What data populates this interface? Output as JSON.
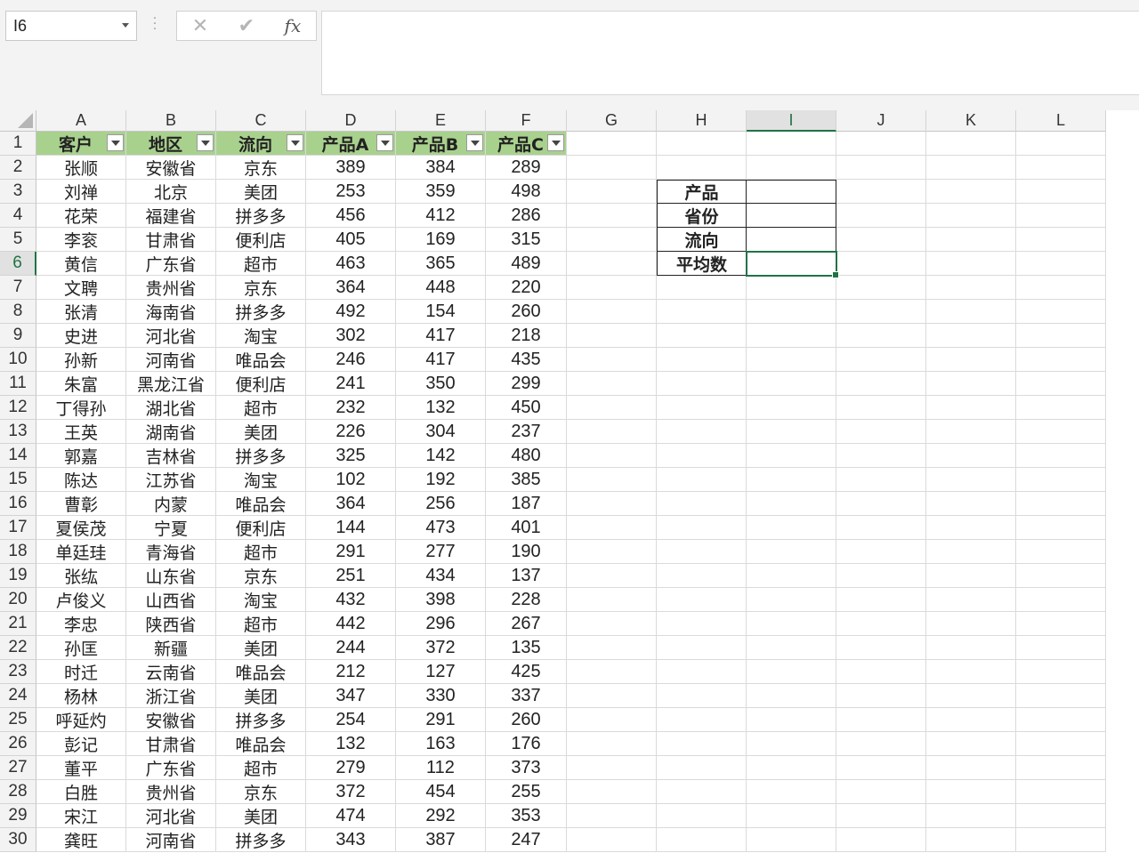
{
  "formula_bar": {
    "name_box": "I6",
    "cancel_icon": "✕",
    "enter_icon": "✔",
    "function_icon": "fx",
    "formula": ""
  },
  "columns": [
    "A",
    "B",
    "C",
    "D",
    "E",
    "F",
    "G",
    "H",
    "I",
    "J",
    "K",
    "L"
  ],
  "selected_column": "I",
  "selected_row": 6,
  "table": {
    "headers": [
      "客户",
      "地区",
      "流向",
      "产品A",
      "产品B",
      "产品C"
    ],
    "header_color": "#a9d18e",
    "rows": [
      [
        "张顺",
        "安徽省",
        "京东",
        "389",
        "384",
        "289"
      ],
      [
        "刘禅",
        "北京",
        "美团",
        "253",
        "359",
        "498"
      ],
      [
        "花荣",
        "福建省",
        "拼多多",
        "456",
        "412",
        "286"
      ],
      [
        "李衮",
        "甘肃省",
        "便利店",
        "405",
        "169",
        "315"
      ],
      [
        "黄信",
        "广东省",
        "超市",
        "463",
        "365",
        "489"
      ],
      [
        "文聘",
        "贵州省",
        "京东",
        "364",
        "448",
        "220"
      ],
      [
        "张清",
        "海南省",
        "拼多多",
        "492",
        "154",
        "260"
      ],
      [
        "史进",
        "河北省",
        "淘宝",
        "302",
        "417",
        "218"
      ],
      [
        "孙新",
        "河南省",
        "唯品会",
        "246",
        "417",
        "435"
      ],
      [
        "朱富",
        "黑龙江省",
        "便利店",
        "241",
        "350",
        "299"
      ],
      [
        "丁得孙",
        "湖北省",
        "超市",
        "232",
        "132",
        "450"
      ],
      [
        "王英",
        "湖南省",
        "美团",
        "226",
        "304",
        "237"
      ],
      [
        "郭嘉",
        "吉林省",
        "拼多多",
        "325",
        "142",
        "480"
      ],
      [
        "陈达",
        "江苏省",
        "淘宝",
        "102",
        "192",
        "385"
      ],
      [
        "曹彰",
        "内蒙",
        "唯品会",
        "364",
        "256",
        "187"
      ],
      [
        "夏侯茂",
        "宁夏",
        "便利店",
        "144",
        "473",
        "401"
      ],
      [
        "单廷珪",
        "青海省",
        "超市",
        "291",
        "277",
        "190"
      ],
      [
        "张纮",
        "山东省",
        "京东",
        "251",
        "434",
        "137"
      ],
      [
        "卢俊义",
        "山西省",
        "淘宝",
        "432",
        "398",
        "228"
      ],
      [
        "李忠",
        "陕西省",
        "超市",
        "442",
        "296",
        "267"
      ],
      [
        "孙匡",
        "新疆",
        "美团",
        "244",
        "372",
        "135"
      ],
      [
        "时迁",
        "云南省",
        "唯品会",
        "212",
        "127",
        "425"
      ],
      [
        "杨林",
        "浙江省",
        "美团",
        "347",
        "330",
        "337"
      ],
      [
        "呼延灼",
        "安徽省",
        "拼多多",
        "254",
        "291",
        "260"
      ],
      [
        "彭记",
        "甘肃省",
        "唯品会",
        "132",
        "163",
        "176"
      ],
      [
        "董平",
        "广东省",
        "超市",
        "279",
        "112",
        "373"
      ],
      [
        "白胜",
        "贵州省",
        "京东",
        "372",
        "454",
        "255"
      ],
      [
        "宋江",
        "河北省",
        "美团",
        "474",
        "292",
        "353"
      ],
      [
        "龚旺",
        "河南省",
        "拼多多",
        "343",
        "387",
        "247"
      ]
    ]
  },
  "criteria_box": {
    "labels": [
      "产品",
      "省份",
      "流向",
      "平均数"
    ],
    "values": [
      "",
      "",
      "",
      ""
    ]
  },
  "accent_color": "#217346"
}
